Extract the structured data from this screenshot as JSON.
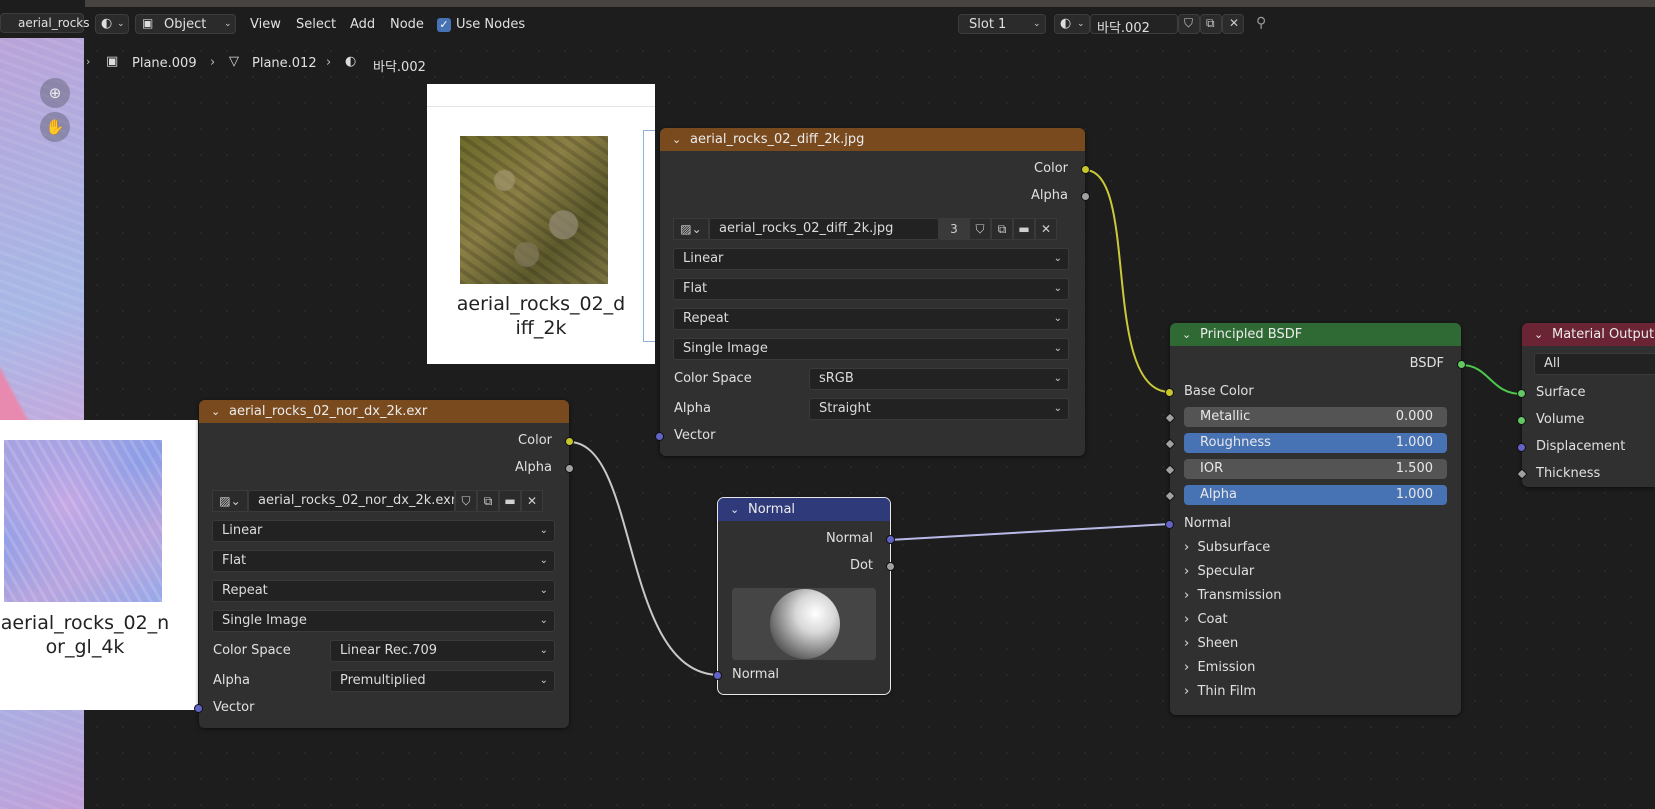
{
  "header": {
    "object_tab": "aerial_rocks",
    "mode": "Object",
    "menus": [
      "View",
      "Select",
      "Add",
      "Node"
    ],
    "use_nodes_label": "Use Nodes",
    "slot": "Slot 1",
    "material_name": "바닥.002"
  },
  "breadcrumb": [
    "Plane.009",
    "Plane.012",
    "바닥.002"
  ],
  "previews": {
    "diffuse_caption_1": "aerial_rocks_02_d",
    "diffuse_caption_2": "iff_2k",
    "normal_caption_1": "aerial_rocks_02_n",
    "normal_caption_2": "or_gl_4k"
  },
  "diff_node": {
    "title": "aerial_rocks_02_diff_2k.jpg",
    "out_color": "Color",
    "out_alpha": "Alpha",
    "image_name": "aerial_rocks_02_diff_2k.jpg",
    "users": "3",
    "interpolation": "Linear",
    "projection": "Flat",
    "extension": "Repeat",
    "source": "Single Image",
    "color_space_label": "Color Space",
    "color_space": "sRGB",
    "alpha_label": "Alpha",
    "alpha_mode": "Straight",
    "in_vector": "Vector"
  },
  "nor_node": {
    "title": "aerial_rocks_02_nor_dx_2k.exr",
    "out_color": "Color",
    "out_alpha": "Alpha",
    "image_name": "aerial_rocks_02_nor_dx_2k.exr",
    "interpolation": "Linear",
    "projection": "Flat",
    "extension": "Repeat",
    "source": "Single Image",
    "color_space_label": "Color Space",
    "color_space": "Linear Rec.709",
    "alpha_label": "Alpha",
    "alpha_mode": "Premultiplied",
    "in_vector": "Vector"
  },
  "normal_node": {
    "title": "Normal",
    "out_normal": "Normal",
    "out_dot": "Dot",
    "in_normal": "Normal"
  },
  "bsdf_node": {
    "title": "Principled BSDF",
    "out_bsdf": "BSDF",
    "base_color": "Base Color",
    "metallic_label": "Metallic",
    "metallic": "0.000",
    "roughness_label": "Roughness",
    "roughness": "1.000",
    "ior_label": "IOR",
    "ior": "1.500",
    "alpha_label": "Alpha",
    "alpha": "1.000",
    "normal": "Normal",
    "panels": [
      "Subsurface",
      "Specular",
      "Transmission",
      "Coat",
      "Sheen",
      "Emission",
      "Thin Film"
    ]
  },
  "output_node": {
    "title": "Material Output",
    "target": "All",
    "inputs": [
      "Surface",
      "Volume",
      "Displacement",
      "Thickness"
    ]
  },
  "colors": {
    "image_header": "#7a4a1f",
    "vector_header": "#2e3a7a",
    "shader_header": "#2f6a34",
    "output_header": "#6a2433",
    "slider_blue": "#4772b3"
  }
}
